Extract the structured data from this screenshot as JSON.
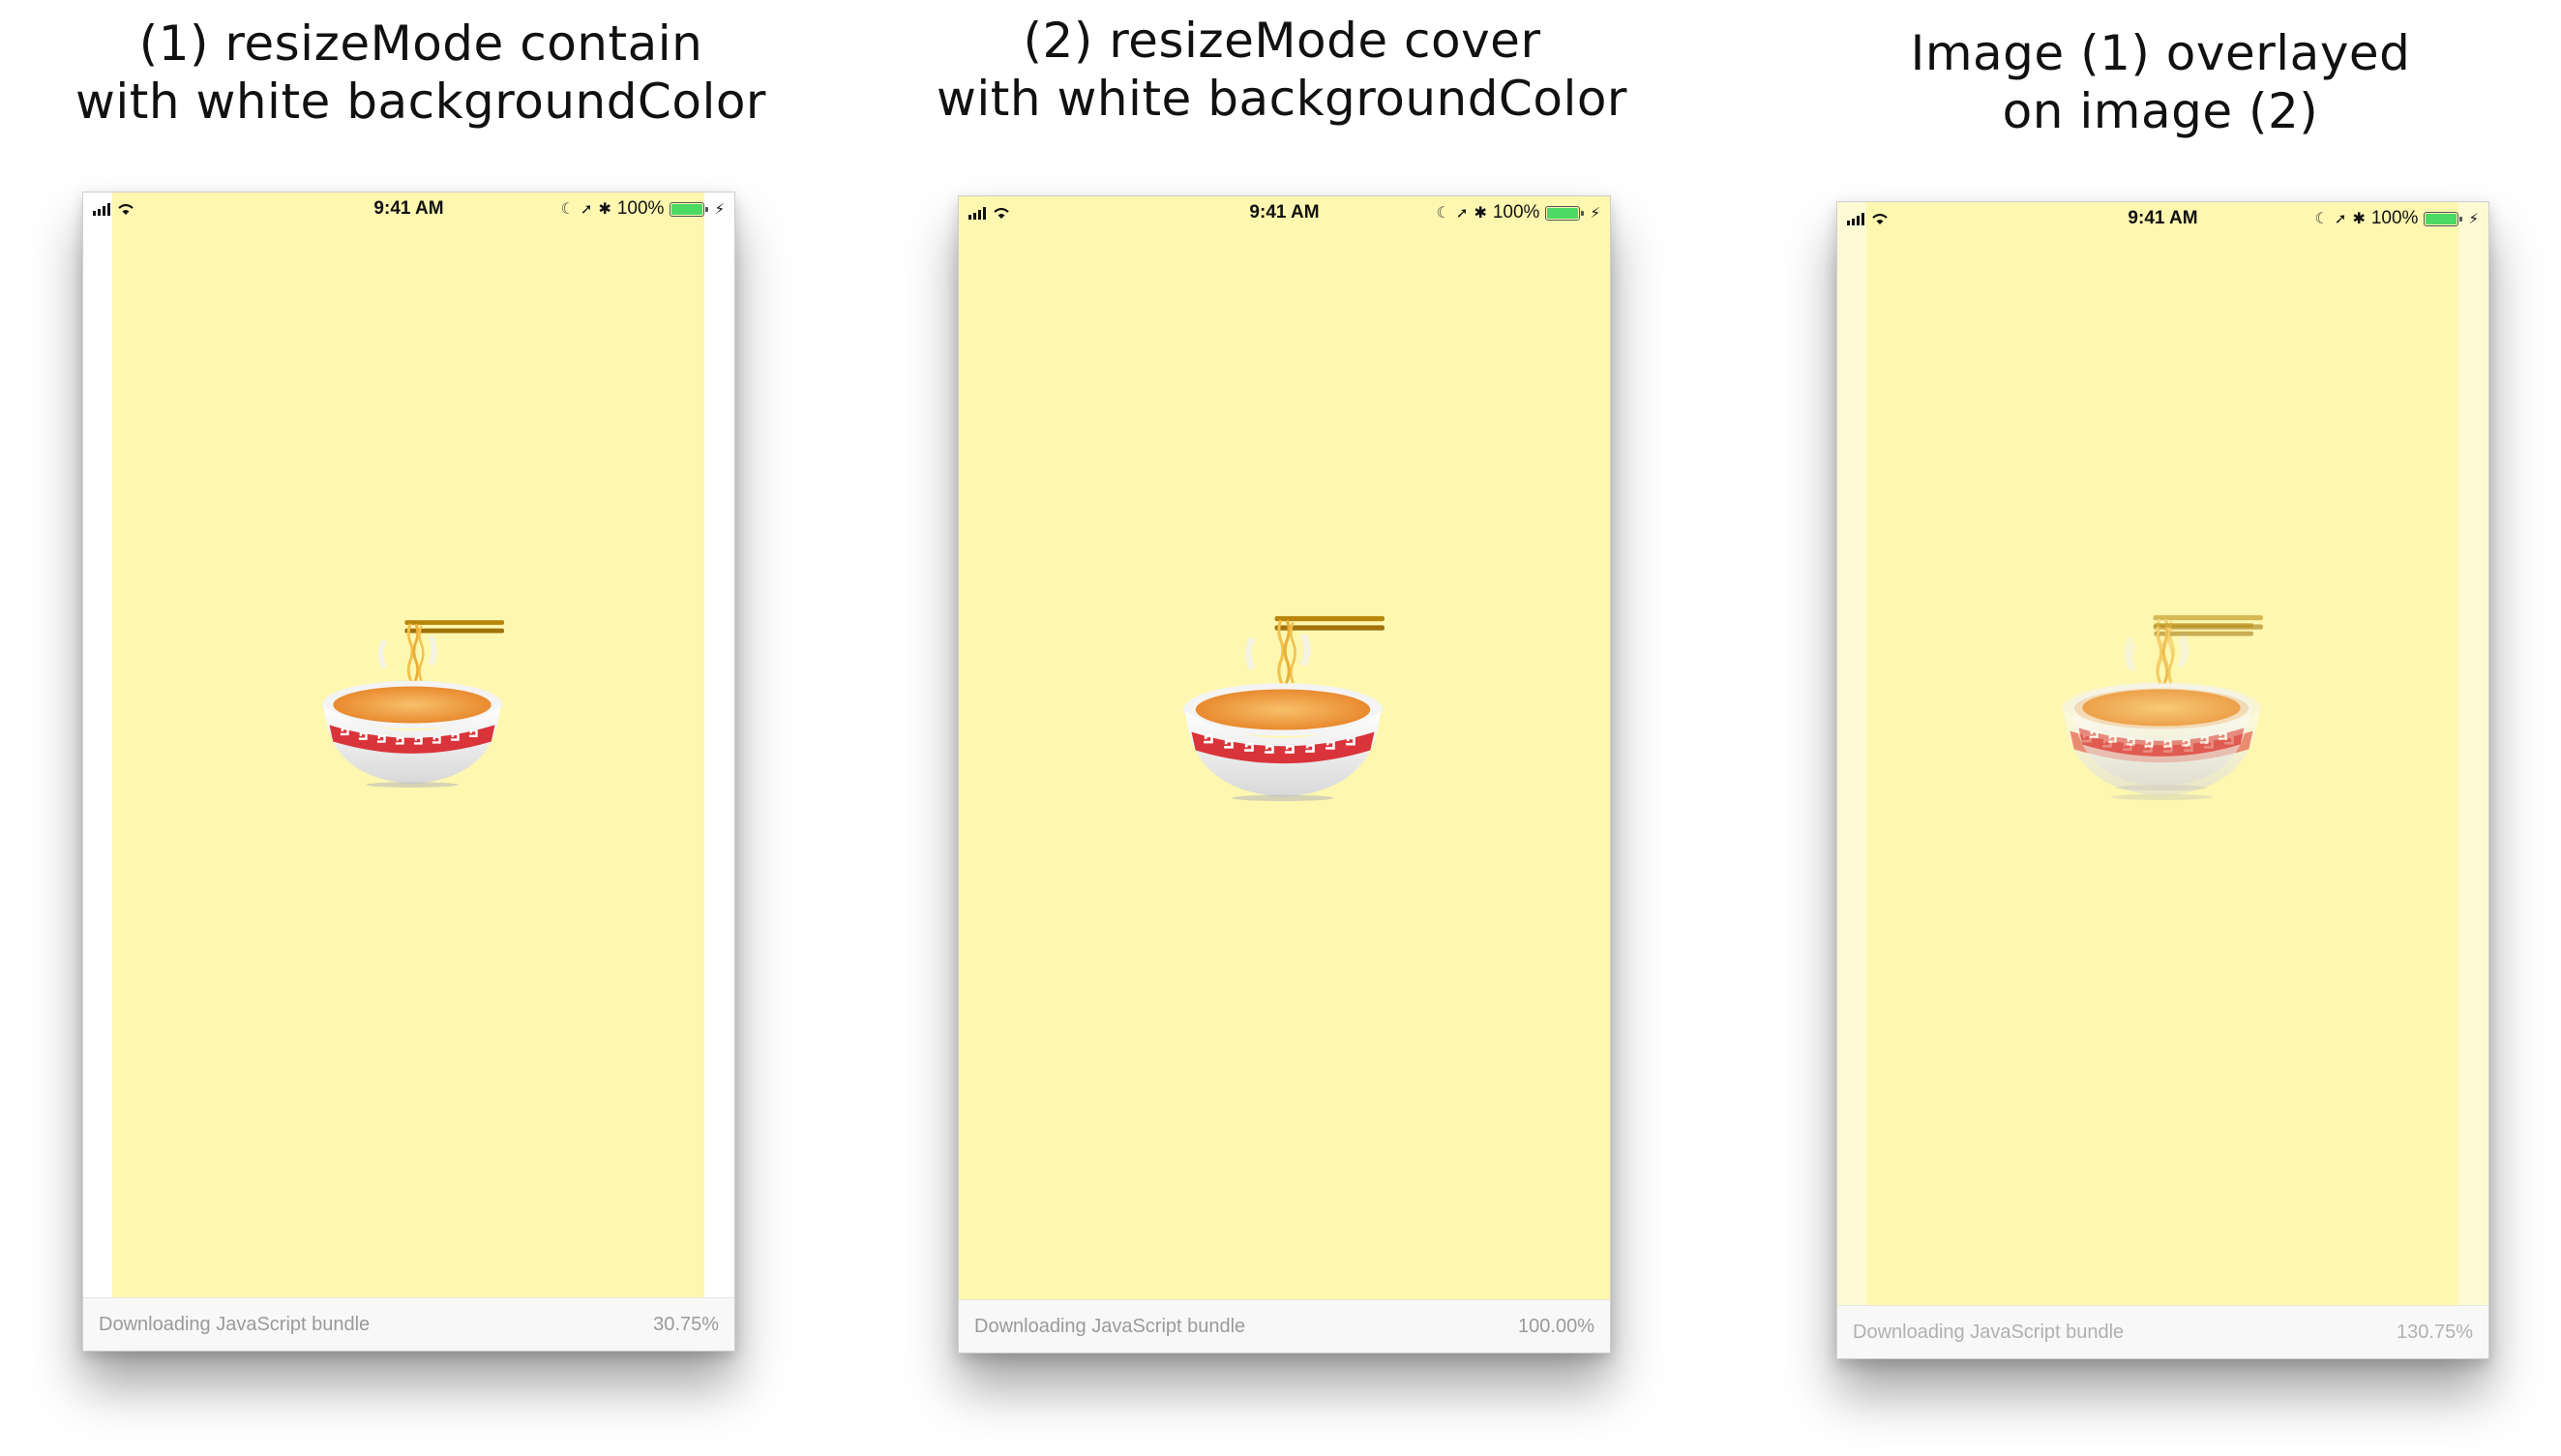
{
  "captions": [
    {
      "line1": "(1) resizeMode contain",
      "line2": "with white backgroundColor"
    },
    {
      "line1": "(2) resizeMode cover",
      "line2": "with white backgroundColor"
    },
    {
      "line1": "Image (1) overlayed",
      "line2": "on image (2)"
    }
  ],
  "status_bar": {
    "time": "9:41 AM",
    "battery_text": "100%",
    "icons": [
      "signal-icon",
      "wifi-icon",
      "moon-icon",
      "location-arrow-icon",
      "bluetooth-icon",
      "battery-icon",
      "charging-bolt-icon"
    ]
  },
  "phones": [
    {
      "bundle_label": "Downloading JavaScript bundle",
      "progress_text": "30.75%"
    },
    {
      "bundle_label": "Downloading JavaScript bundle",
      "progress_text": "100.00%"
    },
    {
      "bundle_label": "Downloading JavaScript bundle",
      "progress_text": "130.75%"
    }
  ],
  "colors": {
    "splash_yellow": "#fdf7b0",
    "bowl_red": "#d9343a",
    "broth_orange": "#f0a24a",
    "battery_green": "#4cd964"
  },
  "emoji": "steaming-bowl-icon"
}
